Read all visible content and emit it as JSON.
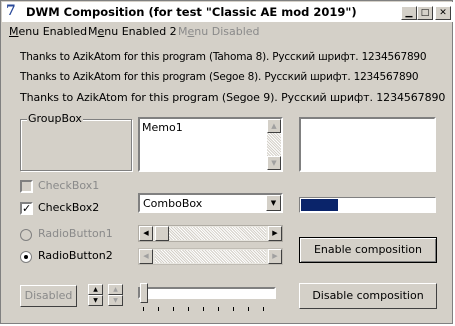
{
  "window": {
    "title": "DWM Composition (for test \"Classic AE mod 2019\")",
    "app_icon": "7"
  },
  "menu": {
    "item1": {
      "first": "M",
      "rest": "enu Enabled"
    },
    "item2": {
      "pre": "M",
      "ul": "e",
      "rest": "nu Enabled 2"
    },
    "item3": {
      "pre": "M",
      "ul": "e",
      "rest": "nu Disabled"
    }
  },
  "lines": [
    "Thanks to AzikAtom for this program (Tahoma 8). Русский шрифт. 1234567890",
    "Thanks to AzikAtom for this program (Segoe 8). Русский шрифт. 1234567890",
    "Thanks to AzikAtom for this program (Segoe 9). Русский шрифт. 1234567890"
  ],
  "groupbox": {
    "label": "GroupBox"
  },
  "memo": {
    "text": "Memo1"
  },
  "checkbox1": {
    "label": "CheckBox1",
    "checked": false,
    "enabled": false
  },
  "checkbox2": {
    "label": "CheckBox2",
    "checked": true,
    "enabled": true
  },
  "combobox": {
    "value": "ComboBox"
  },
  "progress": {
    "value": 0.28,
    "color": "#0a246a"
  },
  "radio1": {
    "label": "RadioButton1",
    "selected": false,
    "enabled": false
  },
  "radio2": {
    "label": "RadioButton2",
    "selected": true,
    "enabled": true
  },
  "buttons": {
    "enable": "Enable composition",
    "disable": "Disable composition",
    "disabled": "Disabled"
  }
}
